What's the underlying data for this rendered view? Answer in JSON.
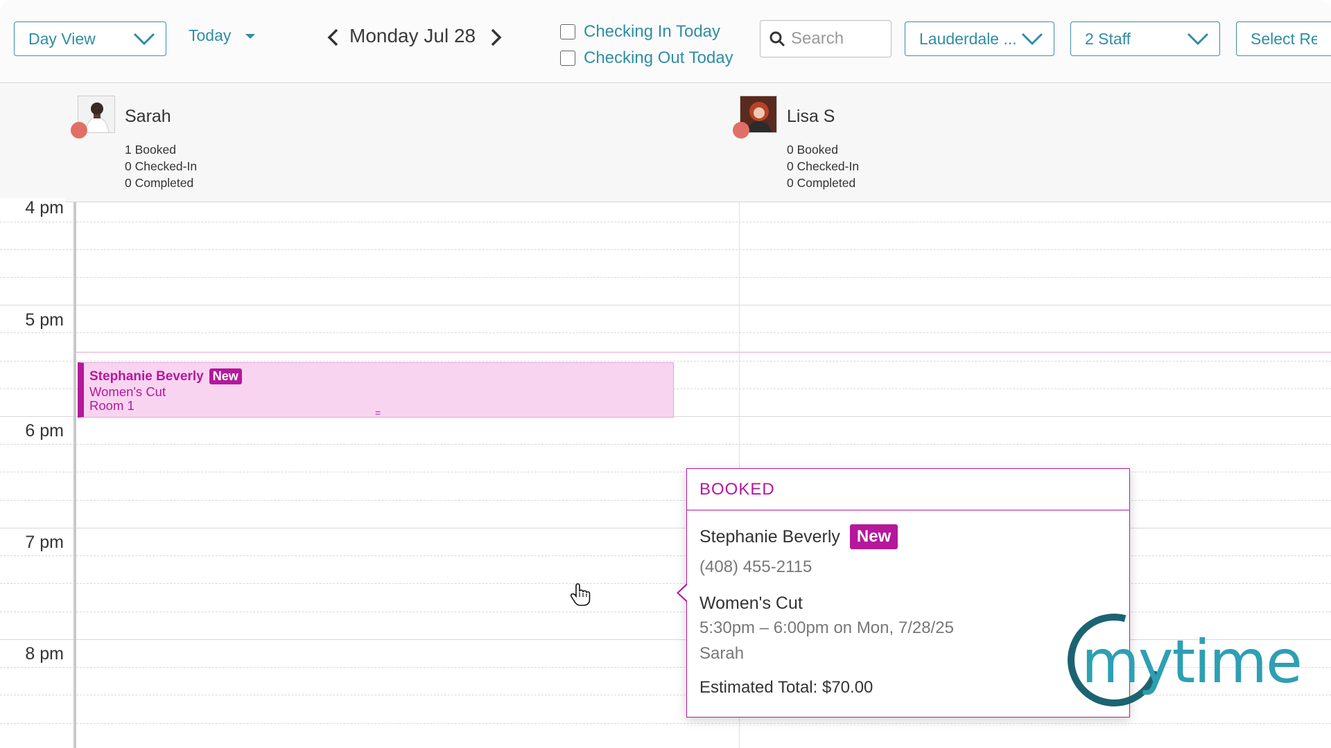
{
  "toolbar": {
    "view_select": "Day View",
    "today": "Today",
    "date": "Monday Jul 28",
    "checking_in": "Checking In Today",
    "checking_out": "Checking Out Today",
    "search_placeholder": "Search",
    "location_select": "Lauderdale ...",
    "staff_select": "2 Staff",
    "resource_select": "Select Reso"
  },
  "staff": [
    {
      "name": "Sarah",
      "booked": "1 Booked",
      "checked_in": "0 Checked-In",
      "completed": "0 Completed"
    },
    {
      "name": "Lisa S",
      "booked": "0 Booked",
      "checked_in": "0 Checked-In",
      "completed": "0 Completed"
    }
  ],
  "time_labels": [
    "4 pm",
    "5 pm",
    "6 pm",
    "7 pm",
    "8 pm"
  ],
  "appointment": {
    "client": "Stephanie Beverly",
    "badge": "New",
    "service": "Women's Cut",
    "room": "Room 1",
    "handle": "="
  },
  "popover": {
    "status": "BOOKED",
    "client": "Stephanie Beverly",
    "badge": "New",
    "phone": "(408) 455-2115",
    "service": "Women's Cut",
    "time": "5:30pm – 6:00pm on Mon, 7/28/25",
    "staff": "Sarah",
    "total": "Estimated Total: $70.00"
  },
  "logo": {
    "text": "mytime"
  },
  "colors": {
    "accent": "#2f8ea3",
    "booked": "#b5189b",
    "appointment_bg": "#f9d4f1",
    "status_dot": "#e07065"
  }
}
